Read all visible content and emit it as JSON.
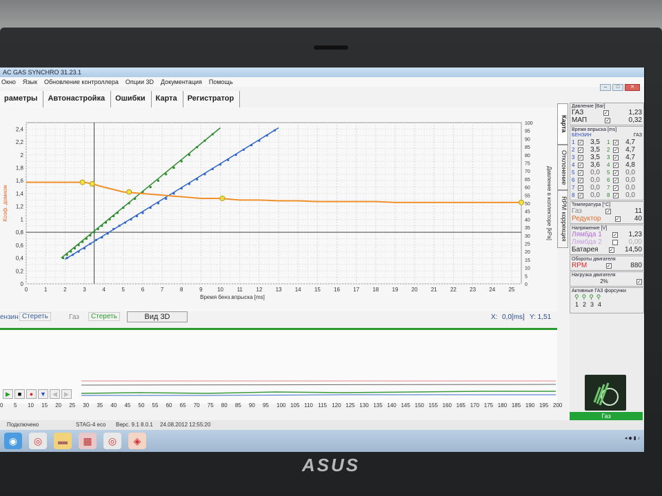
{
  "window": {
    "title": "AC GAS SYNCHRO 31.23.1",
    "menu": [
      "Окно",
      "Язык",
      "Обновление контроллера",
      "Опции 3D",
      "Документация",
      "Помощь"
    ]
  },
  "tabs": [
    "раметры",
    "Автонастройка",
    "Ошибки",
    "Карта",
    "Регистратор"
  ],
  "vertical_tabs": [
    "Карта",
    "Отклонение",
    "RPM коррекция"
  ],
  "chart_data": {
    "type": "scatter",
    "xlabel": "Время бенз.впрыска [ms]",
    "ylabel_left": "Коэф. домнож",
    "ylabel_right": "Давление в коллекторе [kPa]",
    "x_ticks": [
      "0",
      "1",
      "2",
      "3",
      "4",
      "5",
      "6",
      "7",
      "8",
      "9",
      "10",
      "11",
      "12",
      "13",
      "14",
      "15",
      "16",
      "17",
      "18",
      "19",
      "20",
      "21",
      "22",
      "23",
      "24",
      "25"
    ],
    "y_left_ticks": [
      "0",
      "0,2",
      "0,4",
      "0,6",
      "0,8",
      "1",
      "1,2",
      "1,4",
      "1,6",
      "1,8",
      "2",
      "2,2",
      "2,4"
    ],
    "y_right_ticks": [
      "0",
      "5",
      "10",
      "15",
      "20",
      "25",
      "30",
      "35",
      "40",
      "45",
      "50",
      "55",
      "60",
      "65",
      "70",
      "75",
      "80",
      "85",
      "90",
      "95",
      "100"
    ],
    "xlim": [
      0,
      25.5
    ],
    "ylim_left": [
      0,
      2.5
    ],
    "ylim_right": [
      0,
      100
    ],
    "series": [
      {
        "color": "#2e8b2e",
        "line": [
          [
            1.8,
            0.4
          ],
          [
            10,
            2.42
          ]
        ],
        "x": [
          1.9,
          2.1,
          2.3,
          2.5,
          2.7,
          2.9,
          3.1,
          3.3,
          3.5,
          3.7,
          3.9,
          4.1,
          4.3,
          4.5,
          4.7,
          5.0,
          5.3,
          5.6,
          6.0,
          6.4,
          6.8,
          7.2,
          7.6,
          8.0,
          8.4,
          8.8,
          9.2,
          9.6
        ],
        "y": [
          0.4,
          0.45,
          0.5,
          0.55,
          0.6,
          0.65,
          0.7,
          0.75,
          0.8,
          0.85,
          0.9,
          0.95,
          1.0,
          1.05,
          1.1,
          1.18,
          1.25,
          1.32,
          1.42,
          1.5,
          1.6,
          1.7,
          1.8,
          1.9,
          2.0,
          2.12,
          2.22,
          2.32
        ]
      },
      {
        "color": "#2f66c8",
        "line": [
          [
            2,
            0.38
          ],
          [
            13,
            2.42
          ]
        ],
        "x": [
          2.1,
          2.4,
          2.7,
          3.0,
          3.3,
          3.6,
          3.9,
          4.2,
          4.5,
          4.8,
          5.1,
          5.4,
          5.7,
          6.0,
          6.4,
          6.8,
          7.2,
          7.6,
          8.0,
          8.4,
          8.8,
          9.2,
          9.6,
          10.0,
          10.4,
          10.8,
          11.2,
          11.6,
          12.0,
          12.4,
          12.8
        ],
        "y": [
          0.4,
          0.45,
          0.5,
          0.55,
          0.62,
          0.68,
          0.72,
          0.78,
          0.85,
          0.9,
          0.95,
          1.0,
          1.05,
          1.1,
          1.18,
          1.25,
          1.32,
          1.4,
          1.48,
          1.55,
          1.62,
          1.7,
          1.78,
          1.85,
          1.92,
          2.0,
          2.08,
          2.15,
          2.22,
          2.3,
          2.38
        ]
      },
      {
        "color": "#f0902a",
        "axis": "right",
        "x": [
          0,
          1,
          2,
          3,
          3.4,
          4,
          5,
          6,
          7,
          8,
          9,
          10,
          11,
          12,
          13,
          14,
          15,
          16,
          17,
          18,
          19,
          20,
          21,
          22,
          23,
          24,
          25.5
        ],
        "y": [
          63,
          63,
          63,
          63,
          62,
          60,
          57,
          56,
          55,
          54,
          53,
          53,
          52,
          52,
          51.5,
          51.5,
          51,
          51,
          51,
          51,
          50.5,
          50.5,
          50.5,
          50.5,
          50.5,
          50.5,
          50.5
        ]
      }
    ],
    "markers": [
      [
        2.9,
        63
      ],
      [
        3.4,
        62
      ],
      [
        5.3,
        57
      ],
      [
        10.1,
        53
      ],
      [
        25.5,
        50.5
      ]
    ],
    "cursor_x": 3.5,
    "cursor_y_left": 0.8
  },
  "controls": {
    "benzin_label": "ензин",
    "benzin_clear": "Стереть",
    "gas_label": "Газ",
    "gas_clear": "Стереть",
    "view3d": "Вид 3D",
    "coords_x_label": "X:",
    "coords_x": "0,0[ms]",
    "coords_y": "Y: 1,51"
  },
  "bottom_axis": [
    "0",
    "5",
    "10",
    "15",
    "20",
    "25",
    "30",
    "35",
    "40",
    "45",
    "50",
    "55",
    "60",
    "65",
    "70",
    "75",
    "80",
    "85",
    "90",
    "95",
    "100",
    "105",
    "110",
    "115",
    "120",
    "125",
    "130",
    "135",
    "140",
    "145",
    "150",
    "155",
    "160",
    "165",
    "170",
    "175",
    "180",
    "185",
    "190",
    "195",
    "200"
  ],
  "status": {
    "connected": "Подключено",
    "device": "STAG-4 eco",
    "version": "Верс. 9.1  8.0.1",
    "datetime": "24.08.2012 12:55:20"
  },
  "panel": {
    "pressure_title": "Давление [Bar]",
    "gas_label": "ГАЗ",
    "gas_value": "1,23",
    "map_label": "МАП",
    "map_value": "0,32",
    "inj_title": "Время впрыска [ms]",
    "benzin_hdr": "БЕНЗИН",
    "gas_hdr": "ГАЗ",
    "benzin": [
      "3,5",
      "3,5",
      "3,5",
      "3,6",
      "0,0",
      "0,0",
      "0,0",
      "0,0"
    ],
    "gas": [
      "4,7",
      "4,7",
      "4,7",
      "4,8",
      "0,0",
      "0,0",
      "0,0",
      "0,0"
    ],
    "temp_title": "Температура [°C]",
    "temp_gas_label": "Газ",
    "temp_gas": "11",
    "temp_red_label": "Редуктор",
    "temp_red": "40",
    "volt_title": "Напряжение [V]",
    "lambda1_label": "Лямбда 1",
    "lambda1": "1,23",
    "lambda2_label": "Лямбда 2",
    "lambda2": "0,00",
    "battery_label": "Батарея",
    "battery": "14,50",
    "rpm_title": "Обороты двигателя",
    "rpm_label": "RPM",
    "rpm": "880",
    "load_title": "Нагрузка двигателя",
    "load": "2%",
    "inj_active_title": "Активные ГАЗ форсунки",
    "inj_active": [
      "1",
      "2",
      "3",
      "4"
    ],
    "gas_button": "Газ"
  },
  "laptop_brand": "ASUS"
}
